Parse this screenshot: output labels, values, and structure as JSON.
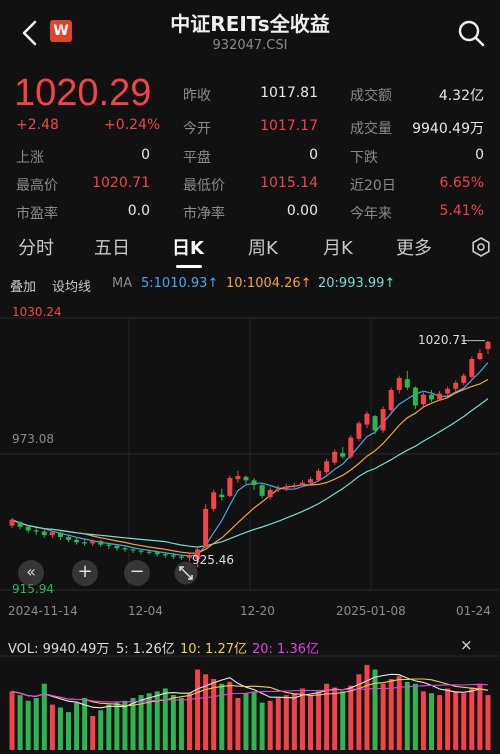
{
  "header": {
    "title": "中证REITs全收益",
    "code": "932047.CSI",
    "badge": "W"
  },
  "quote": {
    "price": "1020.29",
    "change": "+2.48",
    "change_pct": "+0.24%",
    "stats": [
      [
        {
          "label": "昨收",
          "value": "1017.81"
        },
        {
          "label": "成交额",
          "value": "4.32亿"
        }
      ],
      [
        {
          "label": "今开",
          "value": "1017.17"
        },
        {
          "label": "成交量",
          "value": "9940.49万"
        }
      ],
      [
        {
          "label": "上涨",
          "value": "0"
        },
        {
          "label": "平盘",
          "value": "0"
        },
        {
          "label": "下跌",
          "value": "0"
        }
      ],
      [
        {
          "label": "最高价",
          "value": "1020.71"
        },
        {
          "label": "最低价",
          "value": "1015.14"
        },
        {
          "label": "近20日",
          "value": "6.65%"
        }
      ],
      [
        {
          "label": "市盈率",
          "value": "0.0"
        },
        {
          "label": "市净率",
          "value": "0.00"
        },
        {
          "label": "今年来",
          "value": "5.41%"
        }
      ]
    ]
  },
  "tabs": [
    "分时",
    "五日",
    "日K",
    "周K",
    "月K",
    "更多"
  ],
  "toolbar": {
    "overlay": "叠加",
    "drawing": "设均线",
    "ma_label": "MA",
    "ma5": "5:1010.93↑",
    "ma10": "10:1004.26↑",
    "ma20": "20:993.99↑"
  },
  "chart": {
    "y_high_label": "1030.24",
    "y_mid_label": "973.08",
    "y_low_label": "915.94",
    "max_annotation": "1020.71",
    "min_annotation": "925.46",
    "x_labels": [
      "2024-11-14",
      "12-04",
      "12-20",
      "2025-01-08",
      "01-24"
    ],
    "zoom_out": "−",
    "zoom_in": "+",
    "back": "«"
  },
  "volume": {
    "vol_label": "VOL: 9940.49万",
    "ma5": "5: 1.26亿",
    "ma10": "10: 1.27亿",
    "ma20": "20: 1.36亿",
    "close": "×"
  },
  "colors": {
    "up": "#f2424a",
    "down": "#2fb454",
    "ma5": "#4aa6e8",
    "ma10": "#f0a04b",
    "ma20": "#7dd8d0",
    "vol_ma10": "#e8d24a",
    "vol_ma20": "#e040e8"
  },
  "chart_data": {
    "type": "candlestick",
    "title": "中证REITs全收益",
    "ylim": [
      915.94,
      1030.24
    ],
    "x_labels": [
      "2024-11-14",
      "12-04",
      "12-20",
      "2025-01-08",
      "01-24"
    ],
    "candles": [
      {
        "o": 943.0,
        "c": 945.5,
        "h": 946.2,
        "l": 942.0
      },
      {
        "o": 944.5,
        "c": 942.5,
        "h": 945.0,
        "l": 941.5
      },
      {
        "o": 942.5,
        "c": 941.0,
        "h": 943.0,
        "l": 939.8
      },
      {
        "o": 941.0,
        "c": 940.5,
        "h": 942.0,
        "l": 939.0
      },
      {
        "o": 940.5,
        "c": 939.0,
        "h": 941.5,
        "l": 938.0
      },
      {
        "o": 939.0,
        "c": 940.2,
        "h": 941.0,
        "l": 937.8
      },
      {
        "o": 940.0,
        "c": 938.2,
        "h": 940.5,
        "l": 937.0
      },
      {
        "o": 938.2,
        "c": 937.0,
        "h": 939.0,
        "l": 936.0
      },
      {
        "o": 937.0,
        "c": 936.0,
        "h": 938.0,
        "l": 935.0
      },
      {
        "o": 936.0,
        "c": 935.5,
        "h": 937.0,
        "l": 934.5
      },
      {
        "o": 935.5,
        "c": 936.5,
        "h": 937.2,
        "l": 934.5
      },
      {
        "o": 936.5,
        "c": 935.0,
        "h": 937.0,
        "l": 934.0
      },
      {
        "o": 935.0,
        "c": 934.5,
        "h": 935.8,
        "l": 933.2
      },
      {
        "o": 934.5,
        "c": 933.5,
        "h": 935.0,
        "l": 932.5
      },
      {
        "o": 933.5,
        "c": 933.0,
        "h": 934.2,
        "l": 932.0
      },
      {
        "o": 933.0,
        "c": 932.5,
        "h": 933.8,
        "l": 931.5
      },
      {
        "o": 932.5,
        "c": 932.0,
        "h": 933.2,
        "l": 931.0
      },
      {
        "o": 932.0,
        "c": 931.8,
        "h": 932.8,
        "l": 930.8
      },
      {
        "o": 931.8,
        "c": 931.0,
        "h": 932.5,
        "l": 930.0
      },
      {
        "o": 931.0,
        "c": 930.5,
        "h": 932.0,
        "l": 929.5
      },
      {
        "o": 930.5,
        "c": 930.0,
        "h": 931.5,
        "l": 929.0
      },
      {
        "o": 930.0,
        "c": 929.5,
        "h": 931.0,
        "l": 928.5
      },
      {
        "o": 929.5,
        "c": 930.5,
        "h": 931.0,
        "l": 928.0
      },
      {
        "o": 929.0,
        "c": 933.0,
        "h": 933.8,
        "l": 925.46
      },
      {
        "o": 934.0,
        "c": 950.0,
        "h": 952.0,
        "l": 933.0
      },
      {
        "o": 950.0,
        "c": 957.0,
        "h": 958.0,
        "l": 949.0
      },
      {
        "o": 956.0,
        "c": 955.0,
        "h": 958.5,
        "l": 953.5
      },
      {
        "o": 955.5,
        "c": 963.0,
        "h": 964.0,
        "l": 955.0
      },
      {
        "o": 962.5,
        "c": 963.8,
        "h": 966.0,
        "l": 961.0
      },
      {
        "o": 963.5,
        "c": 962.0,
        "h": 964.0,
        "l": 960.5
      },
      {
        "o": 962.0,
        "c": 960.0,
        "h": 963.0,
        "l": 958.0
      },
      {
        "o": 960.0,
        "c": 955.5,
        "h": 960.5,
        "l": 954.5
      },
      {
        "o": 955.0,
        "c": 958.0,
        "h": 959.0,
        "l": 954.0
      },
      {
        "o": 958.0,
        "c": 958.5,
        "h": 960.0,
        "l": 957.0
      },
      {
        "o": 958.5,
        "c": 959.5,
        "h": 960.5,
        "l": 957.5
      },
      {
        "o": 959.5,
        "c": 960.0,
        "h": 961.0,
        "l": 958.5
      },
      {
        "o": 960.0,
        "c": 961.0,
        "h": 962.0,
        "l": 959.5
      },
      {
        "o": 961.0,
        "c": 962.5,
        "h": 963.5,
        "l": 960.0
      },
      {
        "o": 962.0,
        "c": 966.0,
        "h": 967.0,
        "l": 961.5
      },
      {
        "o": 965.5,
        "c": 970.0,
        "h": 971.0,
        "l": 964.5
      },
      {
        "o": 969.5,
        "c": 974.0,
        "h": 975.0,
        "l": 968.5
      },
      {
        "o": 973.5,
        "c": 972.0,
        "h": 976.0,
        "l": 971.0
      },
      {
        "o": 972.0,
        "c": 980.0,
        "h": 981.0,
        "l": 971.0
      },
      {
        "o": 979.5,
        "c": 986.0,
        "h": 987.0,
        "l": 978.5
      },
      {
        "o": 985.5,
        "c": 990.0,
        "h": 991.0,
        "l": 984.0
      },
      {
        "o": 989.0,
        "c": 983.0,
        "h": 989.5,
        "l": 981.5
      },
      {
        "o": 983.0,
        "c": 992.0,
        "h": 993.0,
        "l": 982.0
      },
      {
        "o": 991.5,
        "c": 1000.0,
        "h": 1001.0,
        "l": 990.5
      },
      {
        "o": 1000.0,
        "c": 1005.0,
        "h": 1006.0,
        "l": 998.5
      },
      {
        "o": 1004.5,
        "c": 1001.0,
        "h": 1008.0,
        "l": 1000.0
      },
      {
        "o": 1001.0,
        "c": 993.5,
        "h": 1001.5,
        "l": 992.0
      },
      {
        "o": 994.0,
        "c": 998.0,
        "h": 999.0,
        "l": 993.0
      },
      {
        "o": 998.0,
        "c": 996.0,
        "h": 1000.0,
        "l": 995.0
      },
      {
        "o": 996.0,
        "c": 998.5,
        "h": 999.5,
        "l": 995.5
      },
      {
        "o": 998.5,
        "c": 1000.5,
        "h": 1001.5,
        "l": 997.5
      },
      {
        "o": 1000.5,
        "c": 1003.0,
        "h": 1004.0,
        "l": 999.5
      },
      {
        "o": 1003.0,
        "c": 1006.0,
        "h": 1007.0,
        "l": 1002.0
      },
      {
        "o": 1005.5,
        "c": 1013.0,
        "h": 1014.0,
        "l": 1004.5
      },
      {
        "o": 1013.0,
        "c": 1015.5,
        "h": 1017.0,
        "l": 1012.5
      },
      {
        "o": 1017.17,
        "c": 1020.29,
        "h": 1020.71,
        "l": 1015.14
      }
    ],
    "ma": {
      "ma5": {
        "last": 1010.93
      },
      "ma10": {
        "last": 1004.26
      },
      "ma20": {
        "last": 993.99
      }
    },
    "volume_ma": {
      "ma5": "1.26亿",
      "ma10": "1.27亿",
      "ma20": "1.36亿"
    },
    "volumes": [
      0.62,
      0.58,
      0.52,
      0.55,
      0.7,
      0.48,
      0.45,
      0.4,
      0.5,
      0.55,
      0.36,
      0.42,
      0.48,
      0.5,
      0.52,
      0.55,
      0.58,
      0.6,
      0.62,
      0.65,
      0.58,
      0.55,
      0.6,
      0.85,
      0.8,
      0.75,
      0.7,
      0.72,
      0.55,
      0.6,
      0.62,
      0.5,
      0.52,
      0.55,
      0.58,
      0.6,
      0.65,
      0.58,
      0.62,
      0.7,
      0.66,
      0.62,
      0.68,
      0.8,
      0.9,
      0.85,
      0.7,
      0.75,
      0.78,
      0.72,
      0.7,
      0.62,
      0.6,
      0.58,
      0.65,
      0.62,
      0.6,
      0.66,
      0.7,
      0.58
    ]
  }
}
